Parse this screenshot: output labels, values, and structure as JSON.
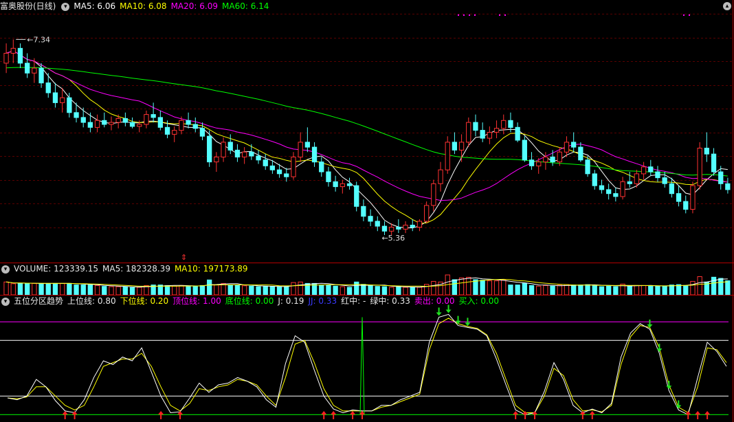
{
  "colors": {
    "bg": "#000000",
    "up": "#ff3232",
    "down": "#54ffff",
    "ma5": "#ffffff",
    "ma10": "#ffff00",
    "ma20": "#ff00ff",
    "ma60": "#00ff00",
    "sep": "#b40000",
    "grid": "#5a0000"
  },
  "price_panel": {
    "title": "富奥股份(日线)",
    "ma5_label": "MA5: 6.06",
    "ma10_label": "MA10: 6.08",
    "ma20_label": "MA20: 6.09",
    "ma60_label": "MA60: 6.14",
    "high_label": "7.34",
    "low_label": "5.36",
    "marker_label": "⇕"
  },
  "volume_panel": {
    "volume_label": "VOLUME: 123339.15",
    "ma5_label": "MA5: 182328.39",
    "ma10_label": "MA10: 197173.89"
  },
  "indicator_panel": {
    "title": "五位分区趋势",
    "upper_label": "上位线: 0.80",
    "lower_label": "下位线: 0.20",
    "top_label": "顶位线: 1.00",
    "bottom_label": "底位线: 0.00",
    "j_label": "J: 0.19",
    "jj_label": "JJ: 0.33",
    "red_mid_label": "红中: -",
    "green_mid_label": "绿中: 0.33",
    "sell_label": "卖出: 0.00",
    "buy_label": "买入: 0.00"
  },
  "chart_data": [
    {
      "type": "candlestick",
      "title": "富奥股份(日线)",
      "ylim": [
        5.2,
        7.6
      ],
      "annotations": {
        "high": 7.34,
        "low": 5.36
      },
      "moving_averages": {
        "MA5": 6.06,
        "MA10": 6.08,
        "MA20": 6.09,
        "MA60": 6.14
      },
      "ohlc": [
        [
          7.1,
          7.3,
          7.0,
          7.2
        ],
        [
          7.2,
          7.34,
          7.1,
          7.25
        ],
        [
          7.25,
          7.3,
          7.05,
          7.1
        ],
        [
          7.1,
          7.2,
          6.95,
          7.0
        ],
        [
          7.0,
          7.15,
          6.9,
          7.05
        ],
        [
          7.05,
          7.1,
          6.85,
          6.9
        ],
        [
          6.9,
          7.0,
          6.75,
          6.8
        ],
        [
          6.8,
          6.9,
          6.65,
          6.7
        ],
        [
          6.7,
          6.85,
          6.6,
          6.75
        ],
        [
          6.75,
          6.8,
          6.55,
          6.6
        ],
        [
          6.6,
          6.7,
          6.5,
          6.55
        ],
        [
          6.55,
          6.65,
          6.45,
          6.5
        ],
        [
          6.5,
          6.6,
          6.4,
          6.45
        ],
        [
          6.45,
          6.58,
          6.4,
          6.52
        ],
        [
          6.52,
          6.6,
          6.45,
          6.48
        ],
        [
          6.48,
          6.56,
          6.42,
          6.5
        ],
        [
          6.5,
          6.58,
          6.44,
          6.54
        ],
        [
          6.54,
          6.6,
          6.46,
          6.5
        ],
        [
          6.5,
          6.55,
          6.44,
          6.46
        ],
        [
          6.46,
          6.52,
          6.4,
          6.48
        ],
        [
          6.48,
          6.62,
          6.44,
          6.58
        ],
        [
          6.58,
          6.7,
          6.5,
          6.55
        ],
        [
          6.55,
          6.62,
          6.42,
          6.45
        ],
        [
          6.45,
          6.52,
          6.34,
          6.38
        ],
        [
          6.38,
          6.46,
          6.3,
          6.42
        ],
        [
          6.42,
          6.56,
          6.38,
          6.52
        ],
        [
          6.52,
          6.6,
          6.44,
          6.48
        ],
        [
          6.48,
          6.55,
          6.4,
          6.44
        ],
        [
          6.44,
          6.5,
          6.32,
          6.36
        ],
        [
          6.36,
          6.42,
          6.05,
          6.1
        ],
        [
          6.1,
          6.2,
          6.0,
          6.15
        ],
        [
          6.15,
          6.35,
          6.1,
          6.3
        ],
        [
          6.3,
          6.38,
          6.18,
          6.22
        ],
        [
          6.22,
          6.28,
          6.1,
          6.15
        ],
        [
          6.15,
          6.25,
          6.08,
          6.2
        ],
        [
          6.2,
          6.28,
          6.12,
          6.16
        ],
        [
          6.16,
          6.22,
          6.08,
          6.12
        ],
        [
          6.12,
          6.18,
          6.02,
          6.06
        ],
        [
          6.06,
          6.12,
          5.98,
          6.02
        ],
        [
          6.02,
          6.08,
          5.94,
          5.98
        ],
        [
          5.98,
          6.04,
          5.9,
          5.95
        ],
        [
          5.95,
          6.2,
          5.92,
          6.15
        ],
        [
          6.15,
          6.4,
          6.1,
          6.3
        ],
        [
          6.3,
          6.45,
          6.2,
          6.25
        ],
        [
          6.25,
          6.3,
          6.05,
          6.1
        ],
        [
          6.1,
          6.15,
          5.95,
          6.0
        ],
        [
          6.0,
          6.05,
          5.85,
          5.9
        ],
        [
          5.9,
          5.96,
          5.8,
          5.85
        ],
        [
          5.85,
          5.92,
          5.78,
          5.88
        ],
        [
          5.88,
          5.94,
          5.82,
          5.86
        ],
        [
          5.86,
          5.9,
          5.6,
          5.65
        ],
        [
          5.65,
          5.72,
          5.5,
          5.55
        ],
        [
          5.55,
          5.62,
          5.45,
          5.5
        ],
        [
          5.5,
          5.55,
          5.4,
          5.45
        ],
        [
          5.45,
          5.5,
          5.36,
          5.4
        ],
        [
          5.4,
          5.48,
          5.36,
          5.44
        ],
        [
          5.44,
          5.52,
          5.38,
          5.42
        ],
        [
          5.42,
          5.5,
          5.38,
          5.46
        ],
        [
          5.46,
          5.52,
          5.4,
          5.44
        ],
        [
          5.44,
          5.52,
          5.4,
          5.5
        ],
        [
          5.5,
          5.7,
          5.48,
          5.66
        ],
        [
          5.66,
          5.92,
          5.6,
          5.88
        ],
        [
          5.88,
          6.1,
          5.8,
          6.02
        ],
        [
          6.02,
          6.36,
          5.98,
          6.3
        ],
        [
          6.3,
          6.4,
          6.18,
          6.22
        ],
        [
          6.22,
          6.38,
          6.1,
          6.3
        ],
        [
          6.3,
          6.55,
          6.25,
          6.5
        ],
        [
          6.5,
          6.58,
          6.36,
          6.42
        ],
        [
          6.42,
          6.5,
          6.3,
          6.34
        ],
        [
          6.34,
          6.46,
          6.28,
          6.4
        ],
        [
          6.4,
          6.52,
          6.34,
          6.44
        ],
        [
          6.44,
          6.58,
          6.38,
          6.52
        ],
        [
          6.52,
          6.6,
          6.4,
          6.45
        ],
        [
          6.45,
          6.5,
          6.3,
          6.32
        ],
        [
          6.32,
          6.36,
          6.1,
          6.12
        ],
        [
          6.12,
          6.2,
          6.02,
          6.06
        ],
        [
          6.06,
          6.14,
          5.98,
          6.1
        ],
        [
          6.1,
          6.2,
          6.02,
          6.15
        ],
        [
          6.15,
          6.22,
          6.06,
          6.1
        ],
        [
          6.1,
          6.25,
          6.06,
          6.2
        ],
        [
          6.2,
          6.36,
          6.15,
          6.3
        ],
        [
          6.3,
          6.4,
          6.2,
          6.25
        ],
        [
          6.25,
          6.3,
          6.1,
          6.12
        ],
        [
          6.12,
          6.16,
          5.95,
          5.98
        ],
        [
          5.98,
          6.02,
          5.82,
          5.86
        ],
        [
          5.86,
          5.92,
          5.78,
          5.82
        ],
        [
          5.82,
          5.88,
          5.72,
          5.78
        ],
        [
          5.78,
          5.84,
          5.7,
          5.75
        ],
        [
          5.75,
          5.95,
          5.72,
          5.9
        ],
        [
          5.9,
          6.0,
          5.84,
          5.88
        ],
        [
          5.88,
          6.02,
          5.84,
          5.98
        ],
        [
          5.98,
          6.1,
          5.92,
          6.05
        ],
        [
          6.05,
          6.12,
          5.96,
          6.0
        ],
        [
          6.0,
          6.06,
          5.9,
          5.94
        ],
        [
          5.94,
          6.0,
          5.84,
          5.88
        ],
        [
          5.88,
          5.94,
          5.74,
          5.78
        ],
        [
          5.78,
          5.86,
          5.65,
          5.7
        ],
        [
          5.7,
          5.76,
          5.58,
          5.62
        ],
        [
          5.62,
          5.9,
          5.58,
          5.86
        ],
        [
          5.86,
          6.3,
          5.82,
          6.24
        ],
        [
          6.24,
          6.4,
          6.1,
          6.18
        ],
        [
          6.18,
          6.24,
          5.96,
          6.0
        ],
        [
          6.0,
          6.06,
          5.82,
          5.88
        ],
        [
          5.88,
          5.94,
          5.78,
          5.82
        ]
      ]
    },
    {
      "type": "bar",
      "title": "VOLUME",
      "labels": {
        "VOLUME": 123339.15,
        "MA5": 182328.39,
        "MA10": 197173.89
      }
    },
    {
      "type": "line",
      "title": "五位分区趋势",
      "levels": {
        "top": 1.0,
        "upper": 0.8,
        "lower": 0.2,
        "bottom": 0.0
      },
      "ylim": [
        -0.05,
        1.15
      ],
      "J": [
        0.18,
        0.16,
        0.2,
        0.38,
        0.3,
        0.15,
        0.04,
        0.02,
        0.16,
        0.4,
        0.58,
        0.54,
        0.62,
        0.58,
        0.72,
        0.46,
        0.2,
        0.02,
        0.03,
        0.18,
        0.34,
        0.24,
        0.32,
        0.34,
        0.4,
        0.36,
        0.3,
        0.16,
        0.08,
        0.55,
        0.85,
        0.78,
        0.48,
        0.2,
        0.06,
        0.02,
        0.05,
        0.04,
        0.04,
        0.1,
        0.1,
        0.16,
        0.2,
        0.24,
        0.78,
        1.05,
        1.08,
        0.96,
        0.94,
        0.92,
        0.85,
        0.6,
        0.32,
        0.05,
        0.0,
        0.02,
        0.25,
        0.56,
        0.38,
        0.1,
        0.02,
        0.06,
        0.02,
        0.12,
        0.62,
        0.88,
        0.98,
        0.92,
        0.66,
        0.26,
        0.05,
        0.0,
        0.4,
        0.78,
        0.68,
        0.52
      ],
      "JJ": [
        0.18,
        0.17,
        0.19,
        0.3,
        0.3,
        0.2,
        0.1,
        0.05,
        0.1,
        0.3,
        0.52,
        0.56,
        0.6,
        0.6,
        0.66,
        0.52,
        0.3,
        0.1,
        0.04,
        0.12,
        0.28,
        0.26,
        0.3,
        0.32,
        0.38,
        0.36,
        0.32,
        0.2,
        0.1,
        0.4,
        0.76,
        0.8,
        0.56,
        0.28,
        0.1,
        0.04,
        0.04,
        0.04,
        0.04,
        0.08,
        0.1,
        0.14,
        0.18,
        0.22,
        0.7,
        0.98,
        1.04,
        0.98,
        0.95,
        0.93,
        0.86,
        0.66,
        0.38,
        0.1,
        0.02,
        0.02,
        0.2,
        0.5,
        0.42,
        0.16,
        0.04,
        0.05,
        0.03,
        0.1,
        0.54,
        0.84,
        0.96,
        0.94,
        0.72,
        0.32,
        0.08,
        0.02,
        0.3,
        0.72,
        0.7,
        0.56
      ],
      "sell_signals": [
        45,
        46,
        47,
        48,
        67,
        68,
        69,
        70
      ],
      "buy_signals": [
        6,
        7,
        16,
        18,
        33,
        34,
        36,
        37,
        53,
        54,
        55,
        60,
        61,
        71,
        72,
        73
      ]
    }
  ]
}
